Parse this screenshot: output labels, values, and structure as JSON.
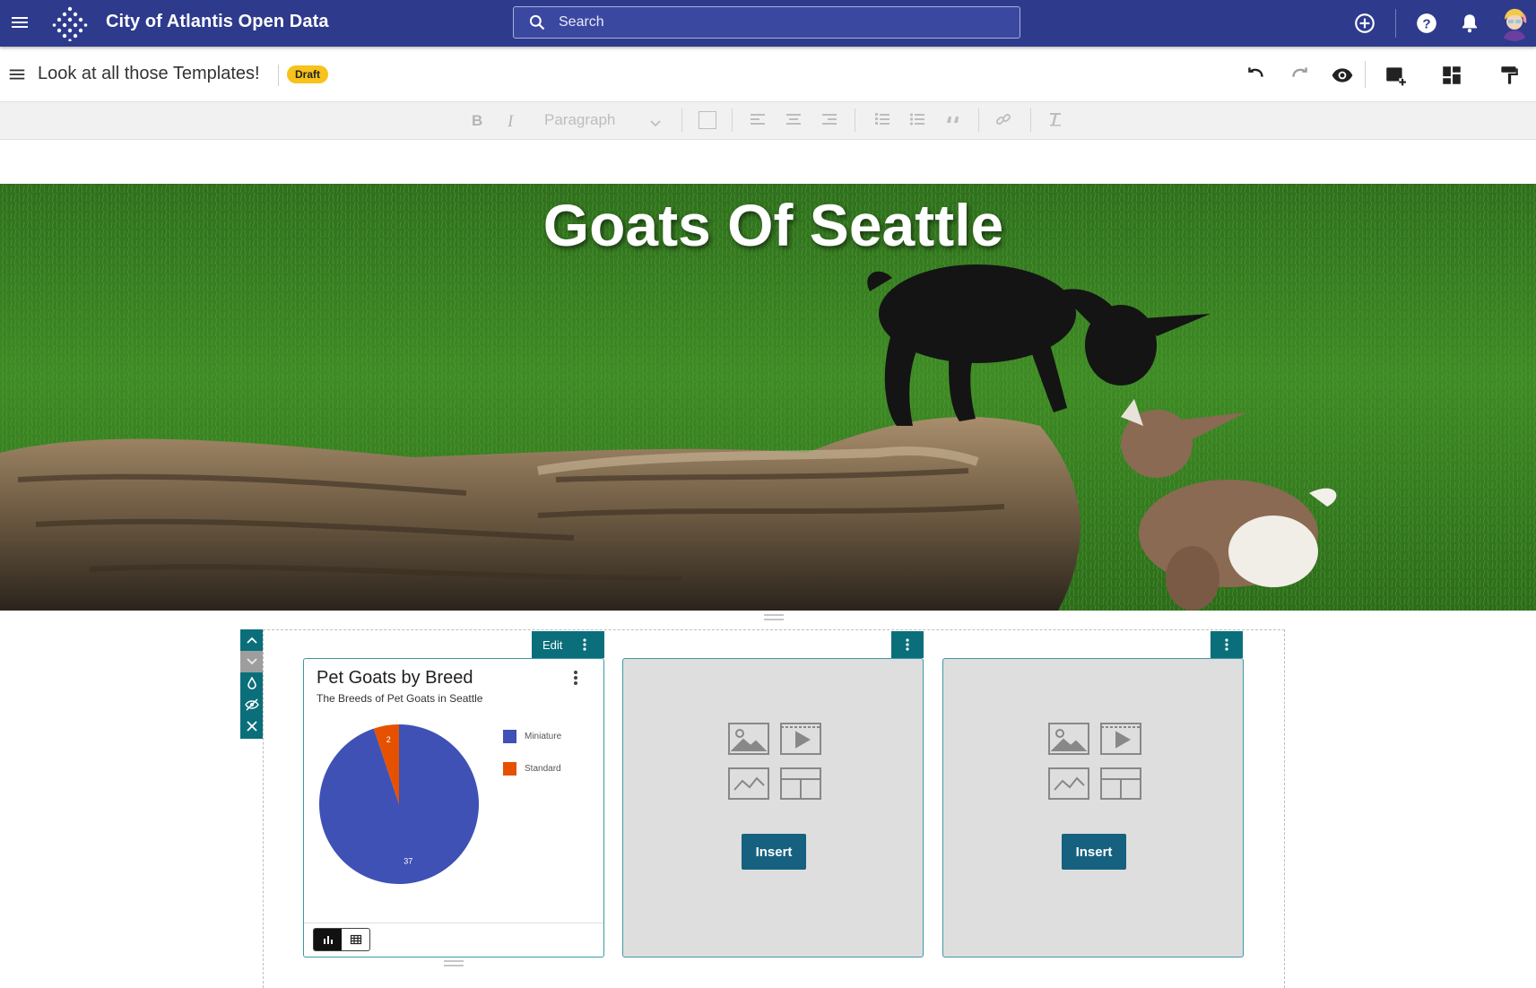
{
  "appbar": {
    "title": "City of Atlantis Open Data",
    "search_placeholder": "Search",
    "icons": [
      "menu-icon",
      "logo-icon",
      "search-icon",
      "add-circle-icon",
      "help-icon",
      "bell-icon",
      "avatar"
    ]
  },
  "document": {
    "title": "Look at all those Templates!",
    "status": "Draft",
    "toolbar_icons": [
      "undo-icon",
      "redo-icon",
      "preview-eye-icon",
      "add-widget-icon",
      "layout-icon",
      "format-paint-icon"
    ]
  },
  "format_bar": {
    "paragraph_label": "Paragraph",
    "bold": "B",
    "italic": "I"
  },
  "hero": {
    "title": "Goats Of Seattle"
  },
  "section": {
    "edit_label": "Edit",
    "chart_card": {
      "title": "Pet Goats by Breed",
      "subtitle": "The Breeds of Pet Goats in Seattle"
    },
    "insert_label": "Insert"
  },
  "chart_data": {
    "type": "pie",
    "title": "Pet Goats by Breed",
    "subtitle": "The Breeds of Pet Goats in Seattle",
    "categories": [
      "Miniature",
      "Standard"
    ],
    "values": [
      37,
      2
    ],
    "colors": [
      "#3f51b5",
      "#e65100"
    ],
    "legend": "right"
  },
  "colors": {
    "appbar": "#2e3a8c",
    "accent_teal": "#0b6f7b",
    "draft_badge": "#f6c21b",
    "insert_button": "#15617f"
  }
}
